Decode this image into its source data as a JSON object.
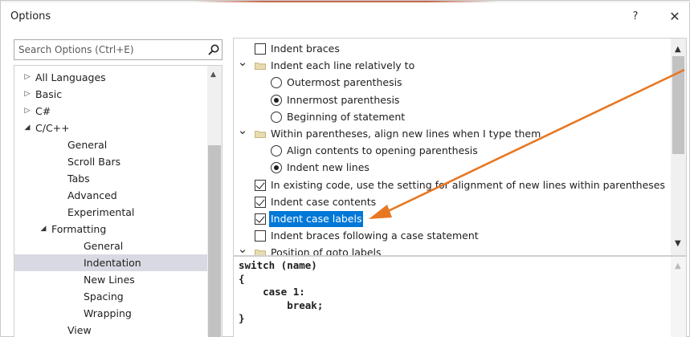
{
  "window": {
    "title": "Options",
    "help": "?",
    "close": "✕"
  },
  "search": {
    "placeholder": "Search Options (Ctrl+E)",
    "value": ""
  },
  "tree": {
    "items": [
      {
        "label": "All Languages",
        "arrow": "▷"
      },
      {
        "label": "Basic",
        "arrow": "▷"
      },
      {
        "label": "C#",
        "arrow": "▷"
      },
      {
        "label": "C/C++",
        "arrow": "◢"
      },
      {
        "label": "General",
        "arrow": ""
      },
      {
        "label": "Scroll Bars",
        "arrow": ""
      },
      {
        "label": "Tabs",
        "arrow": ""
      },
      {
        "label": "Advanced",
        "arrow": ""
      },
      {
        "label": "Experimental",
        "arrow": ""
      },
      {
        "label": "Formatting",
        "arrow": "◢"
      },
      {
        "label": "General",
        "arrow": ""
      },
      {
        "label": "Indentation",
        "arrow": ""
      },
      {
        "label": "New Lines",
        "arrow": ""
      },
      {
        "label": "Spacing",
        "arrow": ""
      },
      {
        "label": "Wrapping",
        "arrow": ""
      },
      {
        "label": "View",
        "arrow": ""
      }
    ],
    "selected": "Indentation"
  },
  "options": {
    "items": [
      {
        "type": "checkbox",
        "label": "Indent braces",
        "checked": false
      },
      {
        "type": "group",
        "label": "Indent each line relatively to"
      },
      {
        "type": "radio",
        "label": "Outermost parenthesis",
        "checked": false
      },
      {
        "type": "radio",
        "label": "Innermost parenthesis",
        "checked": true
      },
      {
        "type": "radio",
        "label": "Beginning of statement",
        "checked": false
      },
      {
        "type": "group",
        "label": "Within parentheses, align new lines when I type them"
      },
      {
        "type": "radio",
        "label": "Align contents to opening parenthesis",
        "checked": false
      },
      {
        "type": "radio",
        "label": "Indent new lines",
        "checked": true
      },
      {
        "type": "checkbox",
        "label": "In existing code, use the setting for alignment of new lines within parentheses",
        "checked": true
      },
      {
        "type": "checkbox",
        "label": "Indent case contents",
        "checked": true
      },
      {
        "type": "checkbox",
        "label": "Indent case labels",
        "checked": true,
        "highlighted": true
      },
      {
        "type": "checkbox",
        "label": "Indent braces following a case statement",
        "checked": false
      },
      {
        "type": "group",
        "label": "Position of goto labels"
      }
    ]
  },
  "preview": {
    "lines": [
      "switch (name)",
      "{",
      "    case 1:",
      "        break;",
      "}"
    ]
  },
  "colors": {
    "selection": "#0078d7",
    "tree_selected": "#d9d9e4",
    "callout_arrow": "#e87722"
  }
}
